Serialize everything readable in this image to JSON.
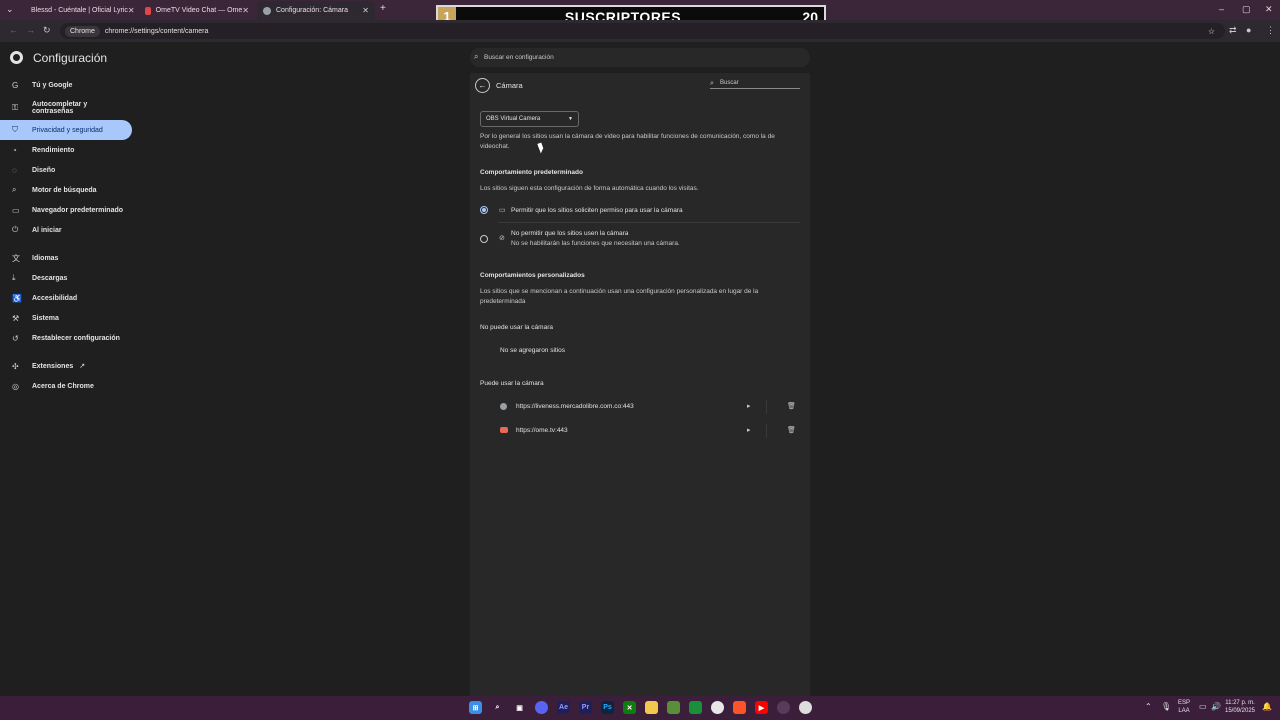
{
  "browser": {
    "tabs": [
      {
        "label": "Blessd - Cuéntale | Oficial Lyric",
        "color": "#ff0000"
      },
      {
        "label": "OmeTV Video Chat — Ome",
        "color": "#e04848"
      },
      {
        "label": "Configuración: Cámara",
        "color": "#9aa0a6"
      }
    ],
    "address_chip": "Chrome",
    "url": "chrome://settings/content/camera"
  },
  "overlay": {
    "rank": "1",
    "label": "SUSCRIPTORES",
    "count": "20"
  },
  "settings": {
    "title": "Configuración",
    "search_placeholder": "Buscar en configuración",
    "nav": [
      {
        "label": "Tú y Google",
        "icon": "google-icon",
        "glyph": "G"
      },
      {
        "label": "Autocompletar y contraseñas",
        "icon": "key-icon",
        "glyph": "⚿"
      },
      {
        "label": "Privacidad y seguridad",
        "icon": "shield-icon",
        "glyph": "⛉"
      },
      {
        "label": "Rendimiento",
        "icon": "speedometer-icon",
        "glyph": "◔"
      },
      {
        "label": "Diseño",
        "icon": "palette-icon",
        "glyph": "◌"
      },
      {
        "label": "Motor de búsqueda",
        "icon": "search-icon",
        "glyph": "⌕"
      },
      {
        "label": "Navegador predeterminado",
        "icon": "browser-icon",
        "glyph": "▭"
      },
      {
        "label": "Al iniciar",
        "icon": "power-icon",
        "glyph": "⏻"
      },
      {
        "label": "Idiomas",
        "icon": "translate-icon",
        "glyph": "文"
      },
      {
        "label": "Descargas",
        "icon": "download-icon",
        "glyph": "⤓"
      },
      {
        "label": "Accesibilidad",
        "icon": "accessibility-icon",
        "glyph": "♿"
      },
      {
        "label": "Sistema",
        "icon": "wrench-icon",
        "glyph": "⚒"
      },
      {
        "label": "Restablecer configuración",
        "icon": "restore-icon",
        "glyph": "↺"
      },
      {
        "label": "Extensiones",
        "icon": "puzzle-icon",
        "glyph": "✣"
      },
      {
        "label": "Acerca de Chrome",
        "icon": "chrome-icon",
        "glyph": "◎"
      }
    ],
    "selected_nav": "Privacidad y seguridad",
    "accent": "#a8c7fa"
  },
  "camera": {
    "title": "Cámara",
    "search_placeholder": "Buscar",
    "device": "OBS Virtual Camera",
    "description": "Por lo general los sitios usan la cámara de video para habilitar funciones de comunicación, como la de videochat.",
    "default_heading": "Comportamiento predeterminado",
    "default_desc": "Los sitios siguen esta configuración de forma automática cuando los visitas.",
    "option_allow": "Permitir que los sitios soliciten permiso para usar la cámara",
    "option_block": "No permitir que los sitios usen la cámara",
    "option_block_sub": "No se habilitarán las funciones que necesitan una cámara.",
    "custom_heading": "Comportamientos personalizados",
    "custom_desc": "Los sitios que se mencionan a continuación usan una configuración personalizada en lugar de la predeterminada",
    "blocked_heading": "No puede usar la cámara",
    "blocked_empty": "No se agregaron sitios",
    "allowed_heading": "Puede usar la cámara",
    "allowed_sites": [
      {
        "url": "https://liveness.mercadolibre.com.co:443",
        "color": "#9aa0a6"
      },
      {
        "url": "https://ome.tv:443",
        "color": "#e86a5a"
      }
    ]
  },
  "taskbar": {
    "language": "ESP",
    "layout": "LAA",
    "time": "11:27 p. m.",
    "date": "15/09/2025"
  }
}
